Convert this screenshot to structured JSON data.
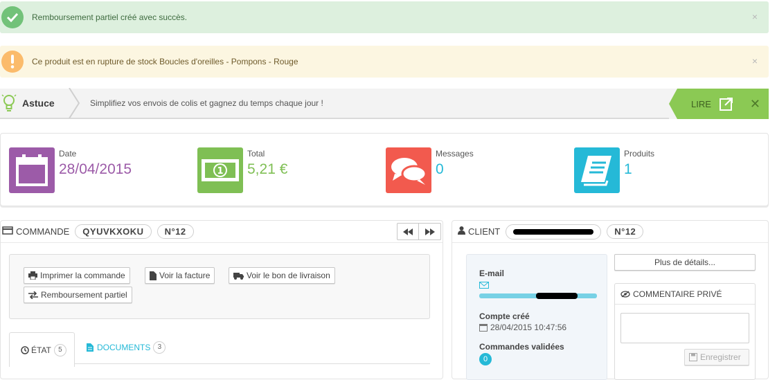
{
  "alerts": {
    "success": "Remboursement partiel créé avec succès.",
    "warning": "Ce produit est en rupture de stock Boucles d'oreilles - Pompons - Rouge",
    "close": "×"
  },
  "tip": {
    "label": "Astuce",
    "message": "Simplifiez vos envois de colis et gagnez du temps chaque jour !",
    "read": "LIRE",
    "close": "✕"
  },
  "kpis": [
    {
      "title": "Date",
      "value": "28/04/2015",
      "color": "#9c5ba8"
    },
    {
      "title": "Total",
      "value": "5,21 €",
      "color": "#7fbf54"
    },
    {
      "title": "Messages",
      "value": "0",
      "color": "#25b9d7"
    },
    {
      "title": "Produits",
      "value": "1",
      "color": "#25b9d7"
    }
  ],
  "order": {
    "header_label": "COMMANDE",
    "reference": "QYUVKXOKU",
    "number": "N°12",
    "buttons": {
      "print": "Imprimer la commande",
      "invoice": "Voir la facture",
      "delivery": "Voir le bon de livraison",
      "refund": "Remboursement partiel"
    },
    "tabs": {
      "state_label": "ÉTAT",
      "state_count": "5",
      "documents_label": "DOCUMENTS",
      "documents_count": "3"
    }
  },
  "client": {
    "header_label": "CLIENT",
    "number": "N°12",
    "more_details": "Plus de détails...",
    "email_label": "E-mail",
    "account_created_label": "Compte créé",
    "account_created_value": "28/04/2015 10:47:56",
    "validated_orders_label": "Commandes validées",
    "validated_orders_count": "0",
    "private_comment_label": "COMMENTAIRE PRIVÉ",
    "save": "Enregistrer"
  }
}
